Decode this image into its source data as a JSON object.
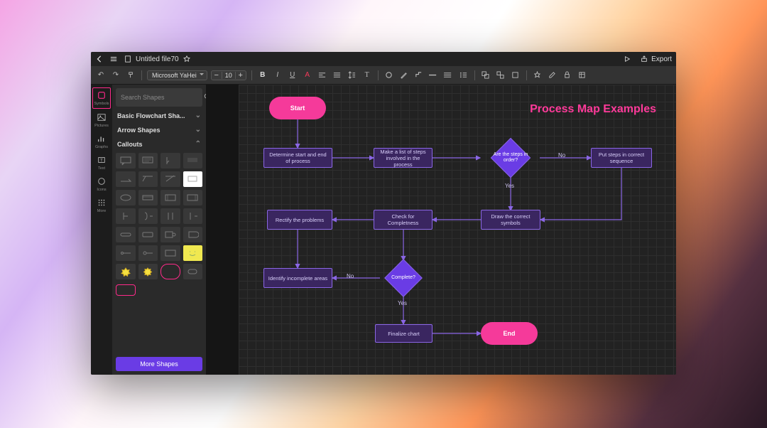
{
  "titlebar": {
    "title": "Untitled file70",
    "export_label": "Export"
  },
  "toolbar": {
    "font_name": "Microsoft YaHei",
    "font_size": "10"
  },
  "rail": {
    "items": [
      {
        "label": "Symbols"
      },
      {
        "label": "Pictures"
      },
      {
        "label": "Graphs"
      },
      {
        "label": "Text"
      },
      {
        "label": "Icons"
      },
      {
        "label": "More"
      }
    ]
  },
  "panel": {
    "search_placeholder": "Search Shapes",
    "categories": [
      {
        "label": "Basic Flowchart Sha...",
        "expanded": false
      },
      {
        "label": "Arrow Shapes",
        "expanded": false
      },
      {
        "label": "Callouts",
        "expanded": true
      }
    ],
    "more_label": "More Shapes"
  },
  "canvas": {
    "title": "Process Map Examples",
    "nodes": {
      "start": "Start",
      "determine": "Determine start and end of process",
      "makelist": "Make a list of steps involved in the process",
      "orderq": "Are the steps in order?",
      "putsteps": "Put steps in correct sequence",
      "rectify": "Rectify the problems",
      "checkcomp": "Check for Completness",
      "drawsym": "Draw the correct symbols",
      "identify": "Identify incomplete areas",
      "completeq": "Complete?",
      "finalize": "Finalize chart",
      "end": "End"
    },
    "labels": {
      "yes": "Yes",
      "no": "No"
    }
  }
}
